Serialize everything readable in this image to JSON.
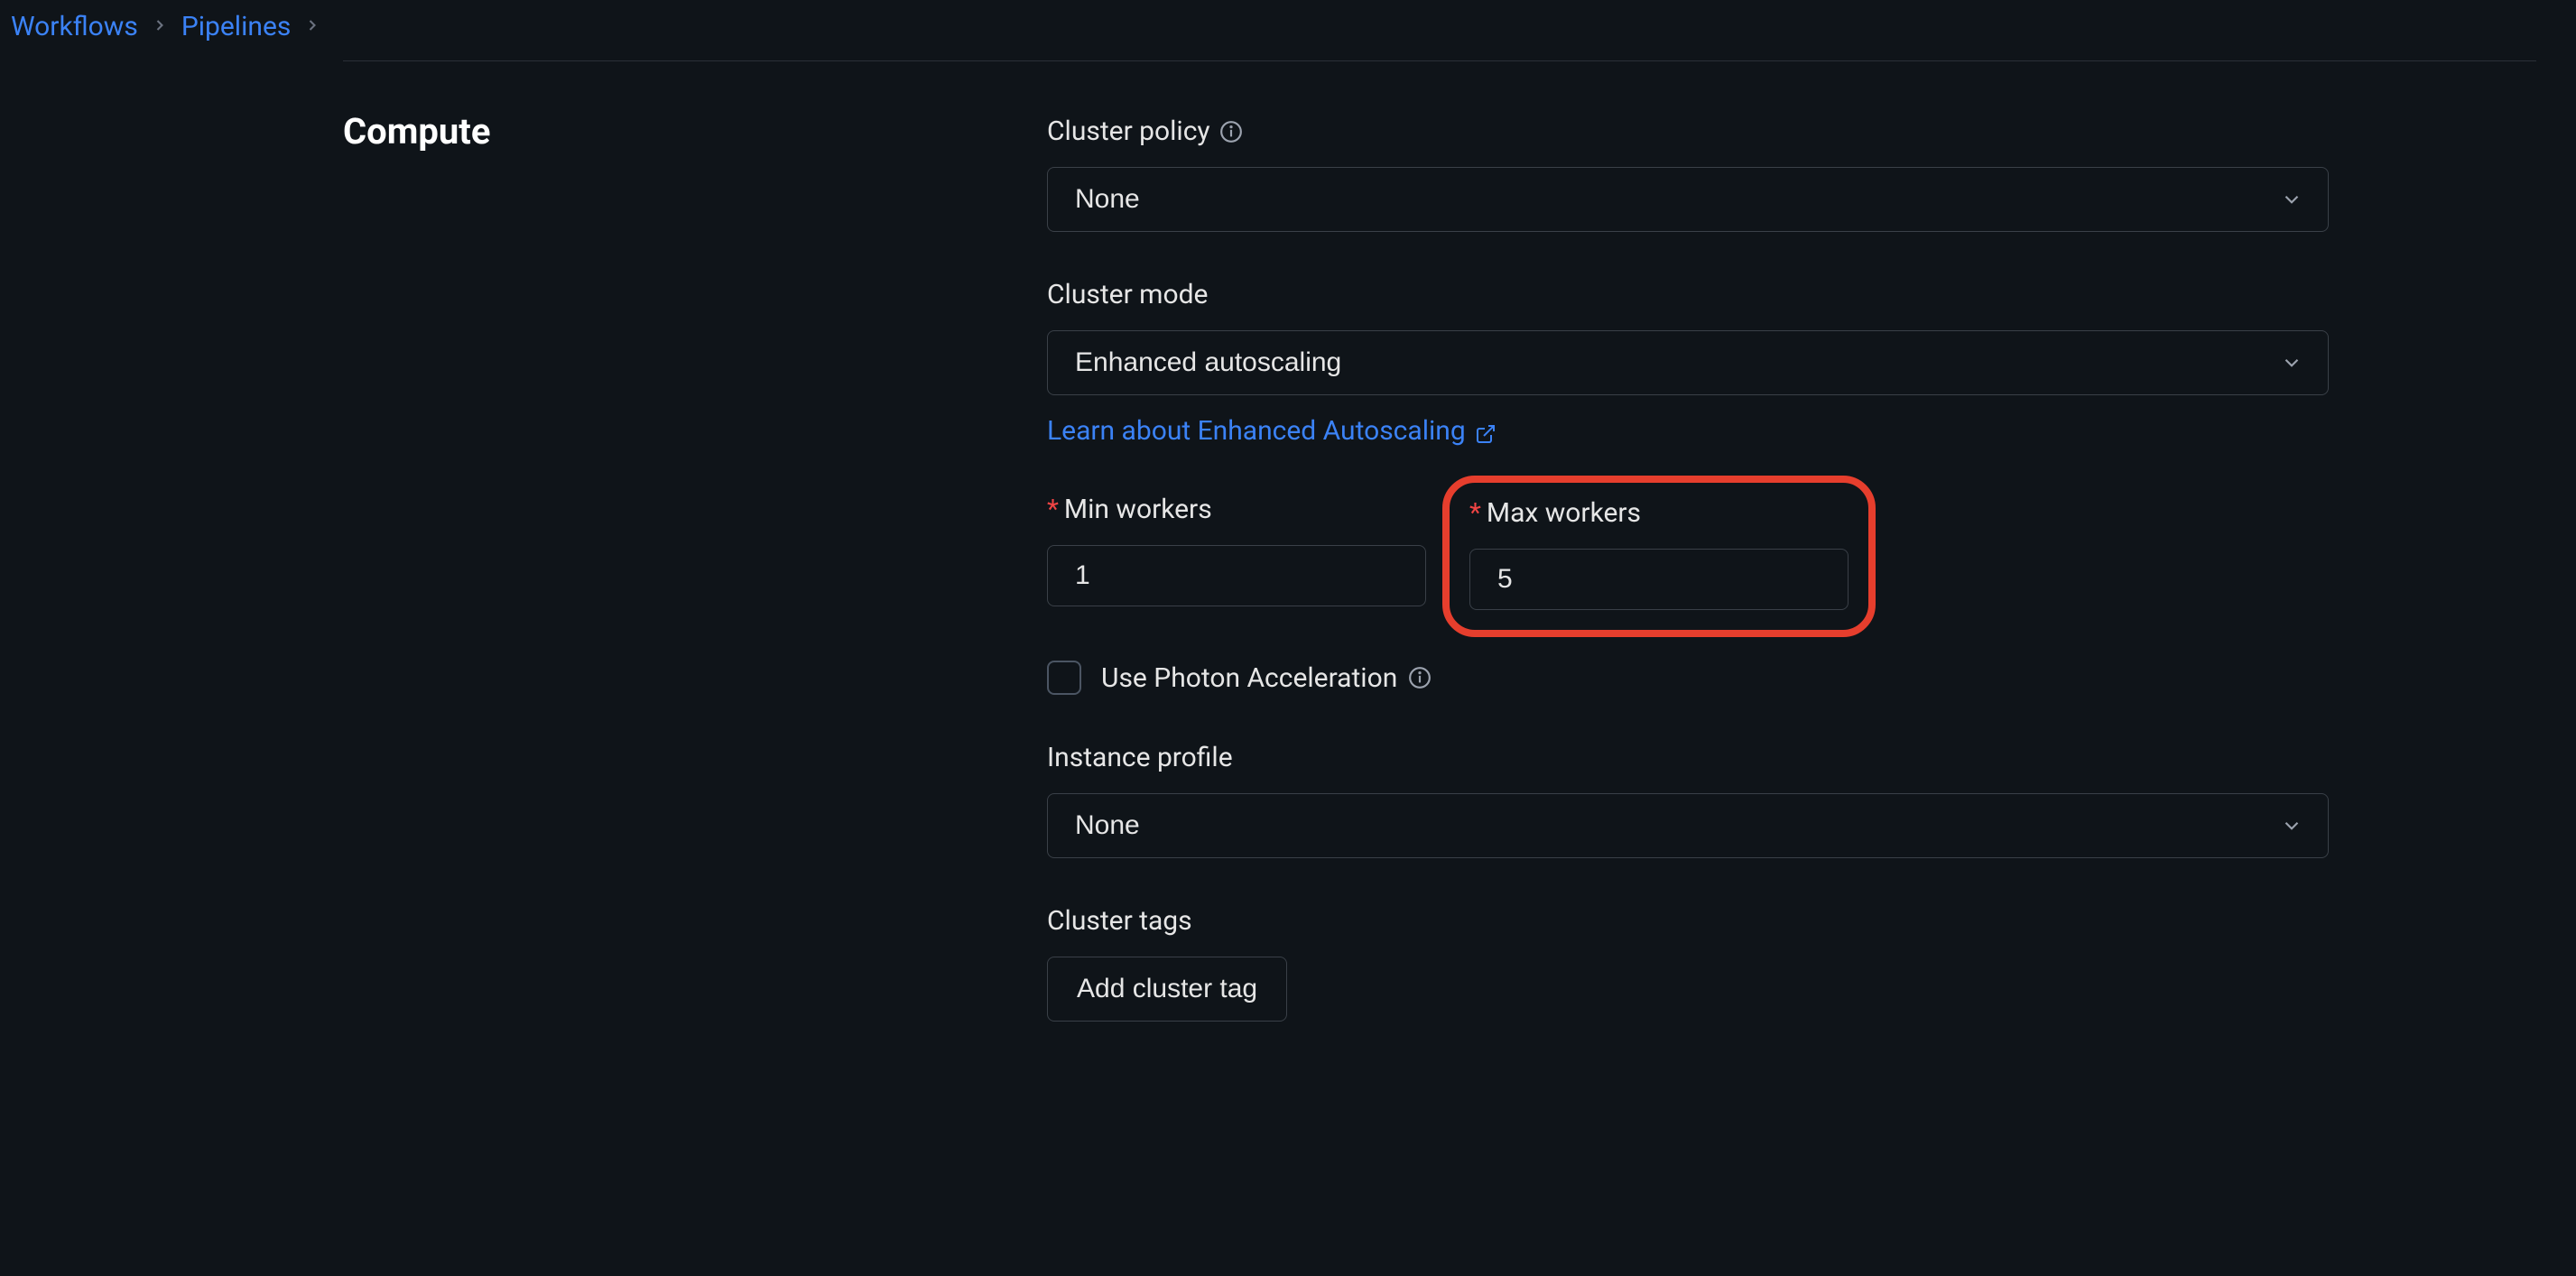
{
  "breadcrumb": {
    "item1": "Workflows",
    "item2": "Pipelines"
  },
  "section": {
    "title": "Compute"
  },
  "cluster_policy": {
    "label": "Cluster policy",
    "value": "None"
  },
  "cluster_mode": {
    "label": "Cluster mode",
    "value": "Enhanced autoscaling",
    "link_text": "Learn about Enhanced Autoscaling"
  },
  "min_workers": {
    "label": "Min workers",
    "value": "1"
  },
  "max_workers": {
    "label": "Max workers",
    "value": "5"
  },
  "photon": {
    "label": "Use Photon Acceleration"
  },
  "instance_profile": {
    "label": "Instance profile",
    "value": "None"
  },
  "cluster_tags": {
    "label": "Cluster tags",
    "button": "Add cluster tag"
  }
}
